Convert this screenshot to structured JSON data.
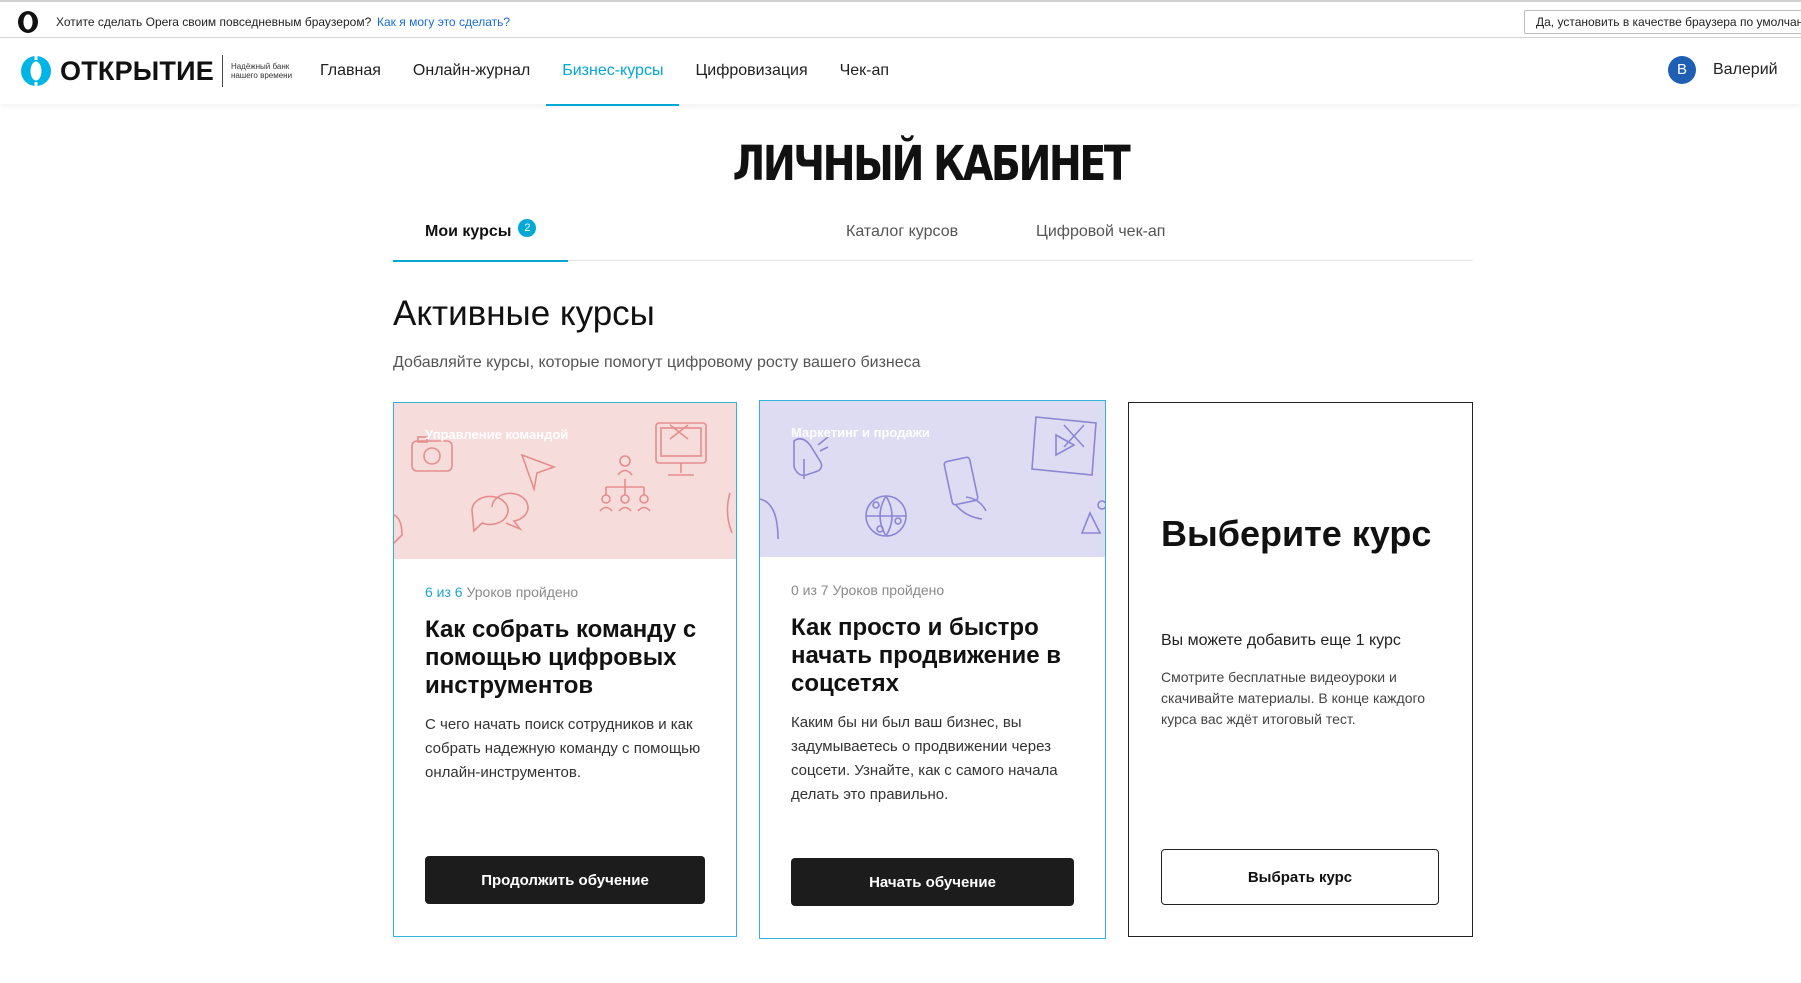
{
  "infobar": {
    "message": "Хотите сделать Opera своим повседневным браузером?",
    "link": "Как я могу это сделать?",
    "button": "Да, установить в качестве браузера по умолчанию"
  },
  "header": {
    "brand_name": "ОТКРЫТИЕ",
    "brand_slogan": "Надёжный банк нашего времени",
    "nav": [
      {
        "label": "Главная",
        "active": false
      },
      {
        "label": "Онлайн-журнал",
        "active": false
      },
      {
        "label": "Бизнес-курсы",
        "active": true
      },
      {
        "label": "Цифровизация",
        "active": false
      },
      {
        "label": "Чек-ап",
        "active": false
      }
    ],
    "user_initial": "В",
    "user_name": "Валерий"
  },
  "page": {
    "title": "ЛИЧНЫЙ КАБИНЕТ",
    "tabs": [
      {
        "label": "Мои курсы",
        "badge": "2",
        "active": true
      },
      {
        "label": "Каталог курсов",
        "active": false
      },
      {
        "label": "Цифровой чек-ап",
        "active": false
      }
    ],
    "section_title": "Активные курсы",
    "section_subtitle": "Добавляйте курсы, которые помогут цифровому росту вашего бизнеса"
  },
  "cards": [
    {
      "category": "Управление командой",
      "progress_done": "6 из 6",
      "progress_label": "Уроков пройдено",
      "title": "Как собрать команду с помощью цифровых инструментов",
      "description": "С чего начать поиск сотрудников и как собрать надежную команду с помощью онлайн-инструментов.",
      "button": "Продолжить обучение"
    },
    {
      "category": "Маркетинг и продажи",
      "progress_done": "0 из 7",
      "progress_label": "Уроков пройдено",
      "title": "Как просто и быстро начать продвижение в соцсетях",
      "description": "Каким бы ни был ваш бизнес, вы задумываетесь о продвижении через соцсети. Узнайте, как с самого начала делать это правильно.",
      "button": "Начать обучение"
    }
  ],
  "choose": {
    "title": "Выберите курс",
    "lead": "Вы можете добавить еще 1 курс",
    "text": "Смотрите бесплатные видеоуроки и скачивайте материалы. В конце каждого курса вас ждёт итоговый тест.",
    "button": "Выбрать курс"
  },
  "colors": {
    "accent": "#00a8d6",
    "card_border": "#32b4e0",
    "card1_bg": "#f7dcdc",
    "card2_bg": "#dddcf2",
    "dark_button": "#1c1c1c",
    "avatar": "#1f5fb3"
  }
}
